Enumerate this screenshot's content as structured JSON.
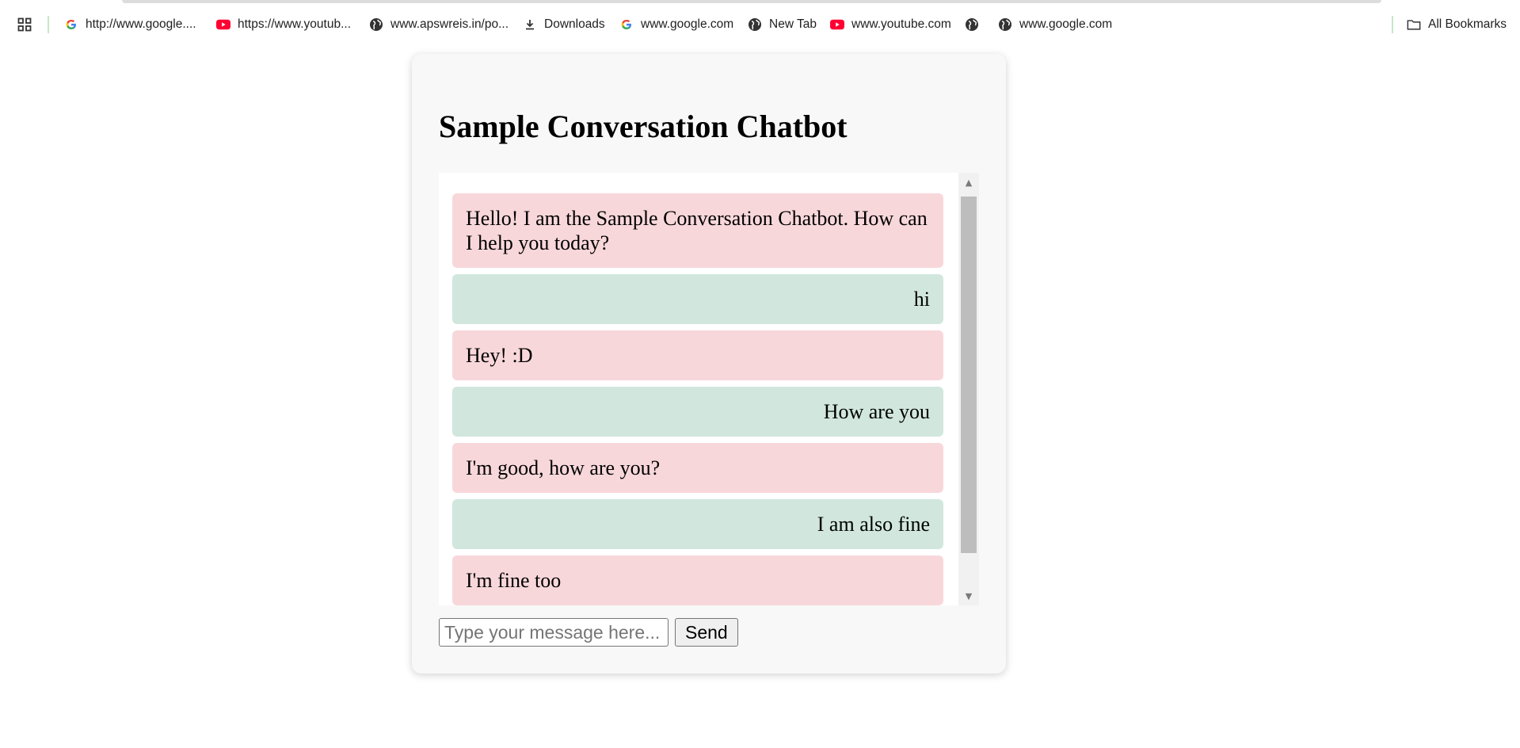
{
  "bookmarks": [
    {
      "label": "http://www.google....",
      "icon": "google-g-icon"
    },
    {
      "label": "https://www.youtub...",
      "icon": "youtube-icon"
    },
    {
      "label": "www.apswreis.in/po...",
      "icon": "globe-icon"
    },
    {
      "label": "Downloads",
      "icon": "download-icon"
    },
    {
      "label": "www.google.com",
      "icon": "google-g-icon"
    },
    {
      "label": "New Tab",
      "icon": "globe-icon"
    },
    {
      "label": "www.youtube.com",
      "icon": "youtube-icon"
    },
    {
      "label": "",
      "icon": "globe-icon"
    },
    {
      "label": "www.google.com",
      "icon": "globe-icon"
    }
  ],
  "all_bookmarks_label": "All Bookmarks",
  "chat": {
    "title": "Sample Conversation Chatbot",
    "messages": [
      {
        "sender": "bot",
        "text": "Hello! I am the Sample Conversation Chatbot. How can I help you today?"
      },
      {
        "sender": "user",
        "text": "hi"
      },
      {
        "sender": "bot",
        "text": "Hey! :D"
      },
      {
        "sender": "user",
        "text": "How are you"
      },
      {
        "sender": "bot",
        "text": "I'm good, how are you?"
      },
      {
        "sender": "user",
        "text": "I am also fine"
      },
      {
        "sender": "bot",
        "text": "I'm fine too"
      }
    ],
    "input_placeholder": "Type your message here...",
    "send_label": "Send"
  },
  "colors": {
    "bot_bubble": "#f8d7da",
    "user_bubble": "#d1e7dd",
    "card_background": "#f8f8f8"
  }
}
